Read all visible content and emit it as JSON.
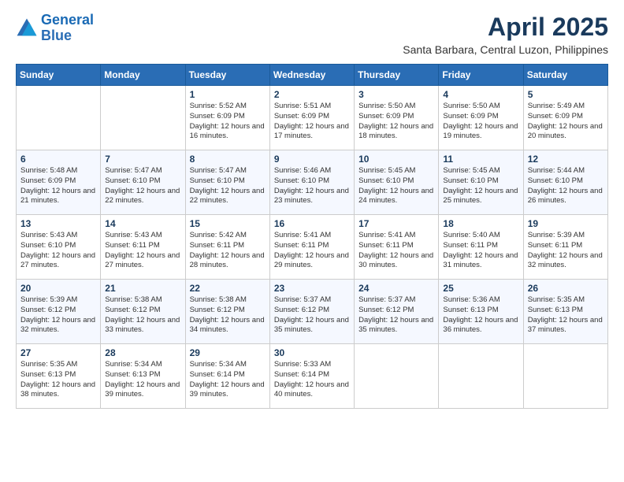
{
  "logo": {
    "line1": "General",
    "line2": "Blue"
  },
  "title": "April 2025",
  "location": "Santa Barbara, Central Luzon, Philippines",
  "days_header": [
    "Sunday",
    "Monday",
    "Tuesday",
    "Wednesday",
    "Thursday",
    "Friday",
    "Saturday"
  ],
  "weeks": [
    [
      {
        "day": "",
        "info": ""
      },
      {
        "day": "",
        "info": ""
      },
      {
        "day": "1",
        "info": "Sunrise: 5:52 AM\nSunset: 6:09 PM\nDaylight: 12 hours and 16 minutes."
      },
      {
        "day": "2",
        "info": "Sunrise: 5:51 AM\nSunset: 6:09 PM\nDaylight: 12 hours and 17 minutes."
      },
      {
        "day": "3",
        "info": "Sunrise: 5:50 AM\nSunset: 6:09 PM\nDaylight: 12 hours and 18 minutes."
      },
      {
        "day": "4",
        "info": "Sunrise: 5:50 AM\nSunset: 6:09 PM\nDaylight: 12 hours and 19 minutes."
      },
      {
        "day": "5",
        "info": "Sunrise: 5:49 AM\nSunset: 6:09 PM\nDaylight: 12 hours and 20 minutes."
      }
    ],
    [
      {
        "day": "6",
        "info": "Sunrise: 5:48 AM\nSunset: 6:09 PM\nDaylight: 12 hours and 21 minutes."
      },
      {
        "day": "7",
        "info": "Sunrise: 5:47 AM\nSunset: 6:10 PM\nDaylight: 12 hours and 22 minutes."
      },
      {
        "day": "8",
        "info": "Sunrise: 5:47 AM\nSunset: 6:10 PM\nDaylight: 12 hours and 22 minutes."
      },
      {
        "day": "9",
        "info": "Sunrise: 5:46 AM\nSunset: 6:10 PM\nDaylight: 12 hours and 23 minutes."
      },
      {
        "day": "10",
        "info": "Sunrise: 5:45 AM\nSunset: 6:10 PM\nDaylight: 12 hours and 24 minutes."
      },
      {
        "day": "11",
        "info": "Sunrise: 5:45 AM\nSunset: 6:10 PM\nDaylight: 12 hours and 25 minutes."
      },
      {
        "day": "12",
        "info": "Sunrise: 5:44 AM\nSunset: 6:10 PM\nDaylight: 12 hours and 26 minutes."
      }
    ],
    [
      {
        "day": "13",
        "info": "Sunrise: 5:43 AM\nSunset: 6:10 PM\nDaylight: 12 hours and 27 minutes."
      },
      {
        "day": "14",
        "info": "Sunrise: 5:43 AM\nSunset: 6:11 PM\nDaylight: 12 hours and 27 minutes."
      },
      {
        "day": "15",
        "info": "Sunrise: 5:42 AM\nSunset: 6:11 PM\nDaylight: 12 hours and 28 minutes."
      },
      {
        "day": "16",
        "info": "Sunrise: 5:41 AM\nSunset: 6:11 PM\nDaylight: 12 hours and 29 minutes."
      },
      {
        "day": "17",
        "info": "Sunrise: 5:41 AM\nSunset: 6:11 PM\nDaylight: 12 hours and 30 minutes."
      },
      {
        "day": "18",
        "info": "Sunrise: 5:40 AM\nSunset: 6:11 PM\nDaylight: 12 hours and 31 minutes."
      },
      {
        "day": "19",
        "info": "Sunrise: 5:39 AM\nSunset: 6:11 PM\nDaylight: 12 hours and 32 minutes."
      }
    ],
    [
      {
        "day": "20",
        "info": "Sunrise: 5:39 AM\nSunset: 6:12 PM\nDaylight: 12 hours and 32 minutes."
      },
      {
        "day": "21",
        "info": "Sunrise: 5:38 AM\nSunset: 6:12 PM\nDaylight: 12 hours and 33 minutes."
      },
      {
        "day": "22",
        "info": "Sunrise: 5:38 AM\nSunset: 6:12 PM\nDaylight: 12 hours and 34 minutes."
      },
      {
        "day": "23",
        "info": "Sunrise: 5:37 AM\nSunset: 6:12 PM\nDaylight: 12 hours and 35 minutes."
      },
      {
        "day": "24",
        "info": "Sunrise: 5:37 AM\nSunset: 6:12 PM\nDaylight: 12 hours and 35 minutes."
      },
      {
        "day": "25",
        "info": "Sunrise: 5:36 AM\nSunset: 6:13 PM\nDaylight: 12 hours and 36 minutes."
      },
      {
        "day": "26",
        "info": "Sunrise: 5:35 AM\nSunset: 6:13 PM\nDaylight: 12 hours and 37 minutes."
      }
    ],
    [
      {
        "day": "27",
        "info": "Sunrise: 5:35 AM\nSunset: 6:13 PM\nDaylight: 12 hours and 38 minutes."
      },
      {
        "day": "28",
        "info": "Sunrise: 5:34 AM\nSunset: 6:13 PM\nDaylight: 12 hours and 39 minutes."
      },
      {
        "day": "29",
        "info": "Sunrise: 5:34 AM\nSunset: 6:14 PM\nDaylight: 12 hours and 39 minutes."
      },
      {
        "day": "30",
        "info": "Sunrise: 5:33 AM\nSunset: 6:14 PM\nDaylight: 12 hours and 40 minutes."
      },
      {
        "day": "",
        "info": ""
      },
      {
        "day": "",
        "info": ""
      },
      {
        "day": "",
        "info": ""
      }
    ]
  ]
}
